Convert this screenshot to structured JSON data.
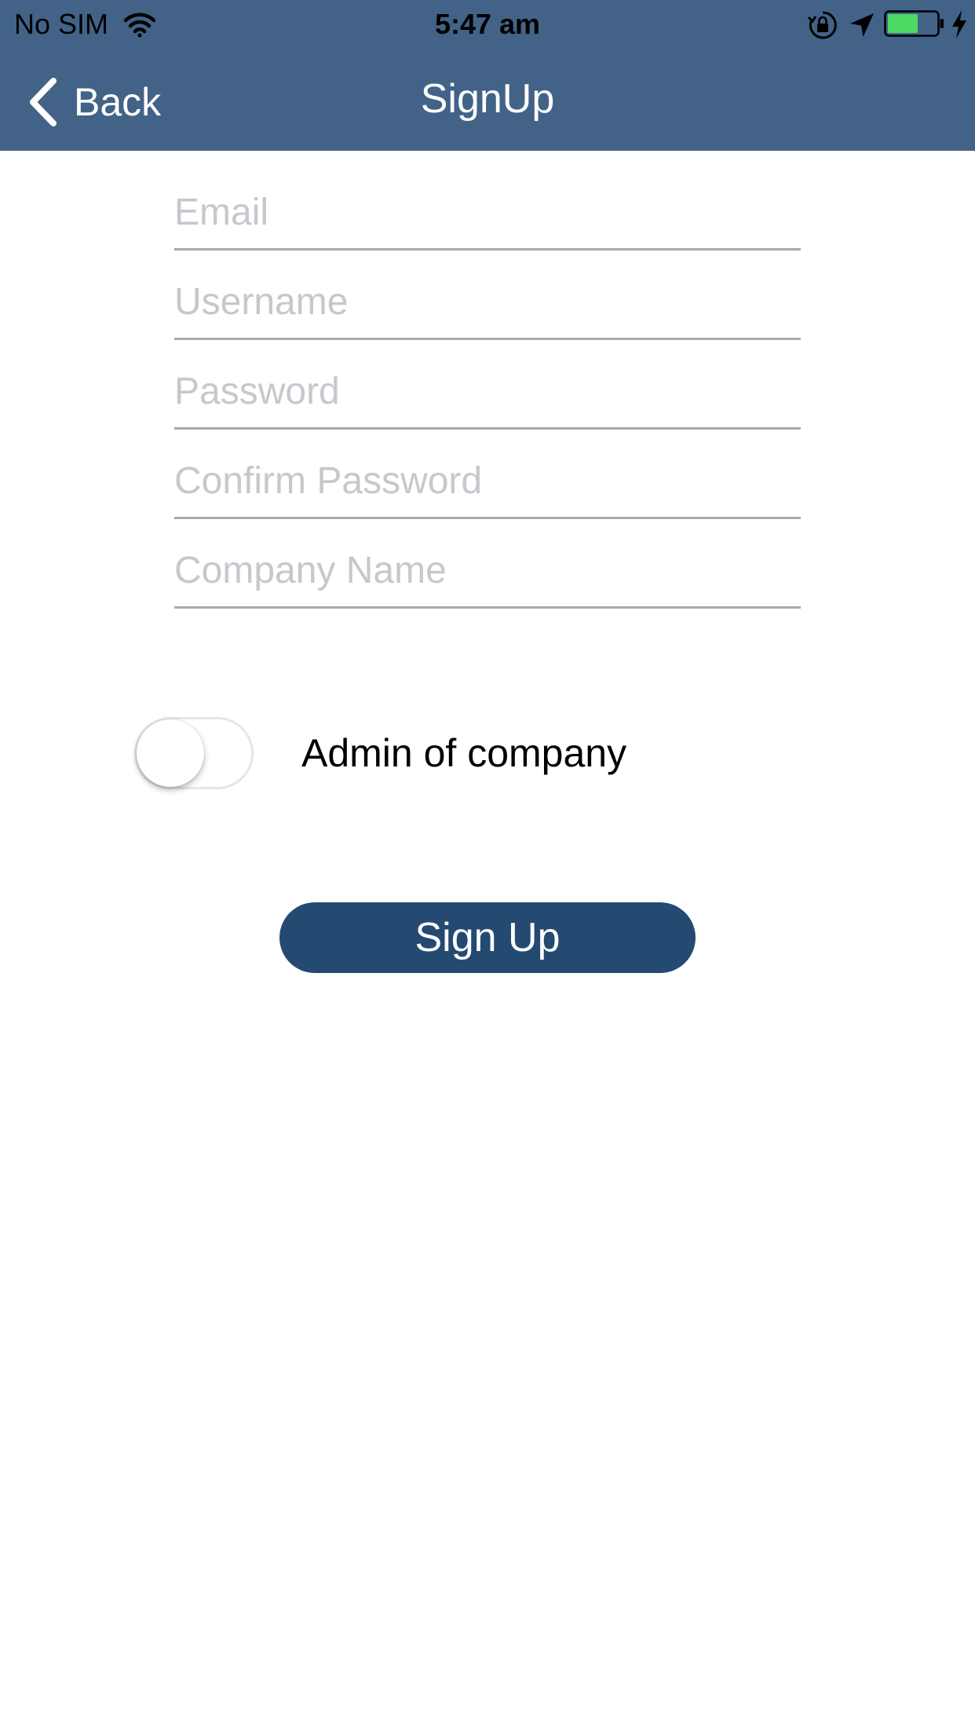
{
  "status_bar": {
    "carrier": "No SIM",
    "time": "5:47 am",
    "icons": [
      "wifi-icon",
      "orientation-lock-icon",
      "location-arrow-icon",
      "battery-icon",
      "charging-bolt-icon"
    ]
  },
  "nav": {
    "back_label": "Back",
    "title": "SignUp"
  },
  "form": {
    "email_placeholder": "Email",
    "username_placeholder": "Username",
    "password_placeholder": "Password",
    "confirm_password_placeholder": "Confirm Password",
    "company_name_placeholder": "Company Name",
    "admin_toggle_label": "Admin of company",
    "admin_toggle_on": false,
    "submit_label": "Sign Up"
  },
  "colors": {
    "nav_background": "#426387",
    "button_background": "#244a72",
    "battery_fill": "#4cd964",
    "placeholder": "#c7c7cd",
    "field_underline": "#a9a9a9"
  }
}
